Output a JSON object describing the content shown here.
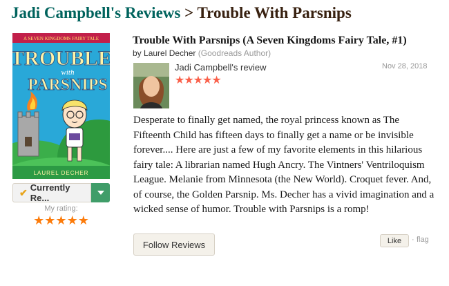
{
  "heading": {
    "reviewer": "Jadi Campbell's Reviews",
    "separator": ">",
    "book": "Trouble With Parsnips"
  },
  "cover": {
    "series_text": "A SEVEN KINGDOMS FAIRY TALE",
    "title_line1": "TROUBLE",
    "title_line2": "with",
    "title_line3": "PARSNIPS",
    "author_text": "LAUREL DECHER"
  },
  "shelf": {
    "label": "Currently Re...",
    "check_icon": "checkmark-icon",
    "dropdown_icon": "caret-down-icon"
  },
  "my_rating": {
    "label": "My rating:",
    "stars": "★★★★★"
  },
  "book": {
    "title": "Trouble With Parsnips (A Seven Kingdoms Fairy Tale, #1)",
    "by": "by",
    "author": "Laurel Decher",
    "author_tag": "(Goodreads Author)"
  },
  "review": {
    "reviewer_name": "Jadi Campbell's",
    "review_word": "review",
    "stars": "★★★★★",
    "date": "Nov 28, 2018",
    "body": "Desperate to finally get named, the royal princess known as The Fifteenth Child has fifteen days to finally get a name or be invisible forever.... Here are just a few of my favorite elements in this hilarious fairy tale: A librarian named Hugh Ancry. The Vintners' Ventriloquism League. Melanie from Minnesota (the New World). Croquet fever. And, of course, the Golden Parsnip. Ms. Decher has a vivid imagination and a wicked sense of humor. Trouble with Parsnips is a romp!"
  },
  "actions": {
    "follow": "Follow Reviews",
    "like": "Like",
    "separator": "·",
    "flag": "flag"
  },
  "colors": {
    "reviewer_link": "#00635d",
    "heading_dark": "#382110",
    "rating_orange": "#fc7b0a",
    "review_stars": "#fa604a",
    "shelf_green": "#409d69"
  }
}
